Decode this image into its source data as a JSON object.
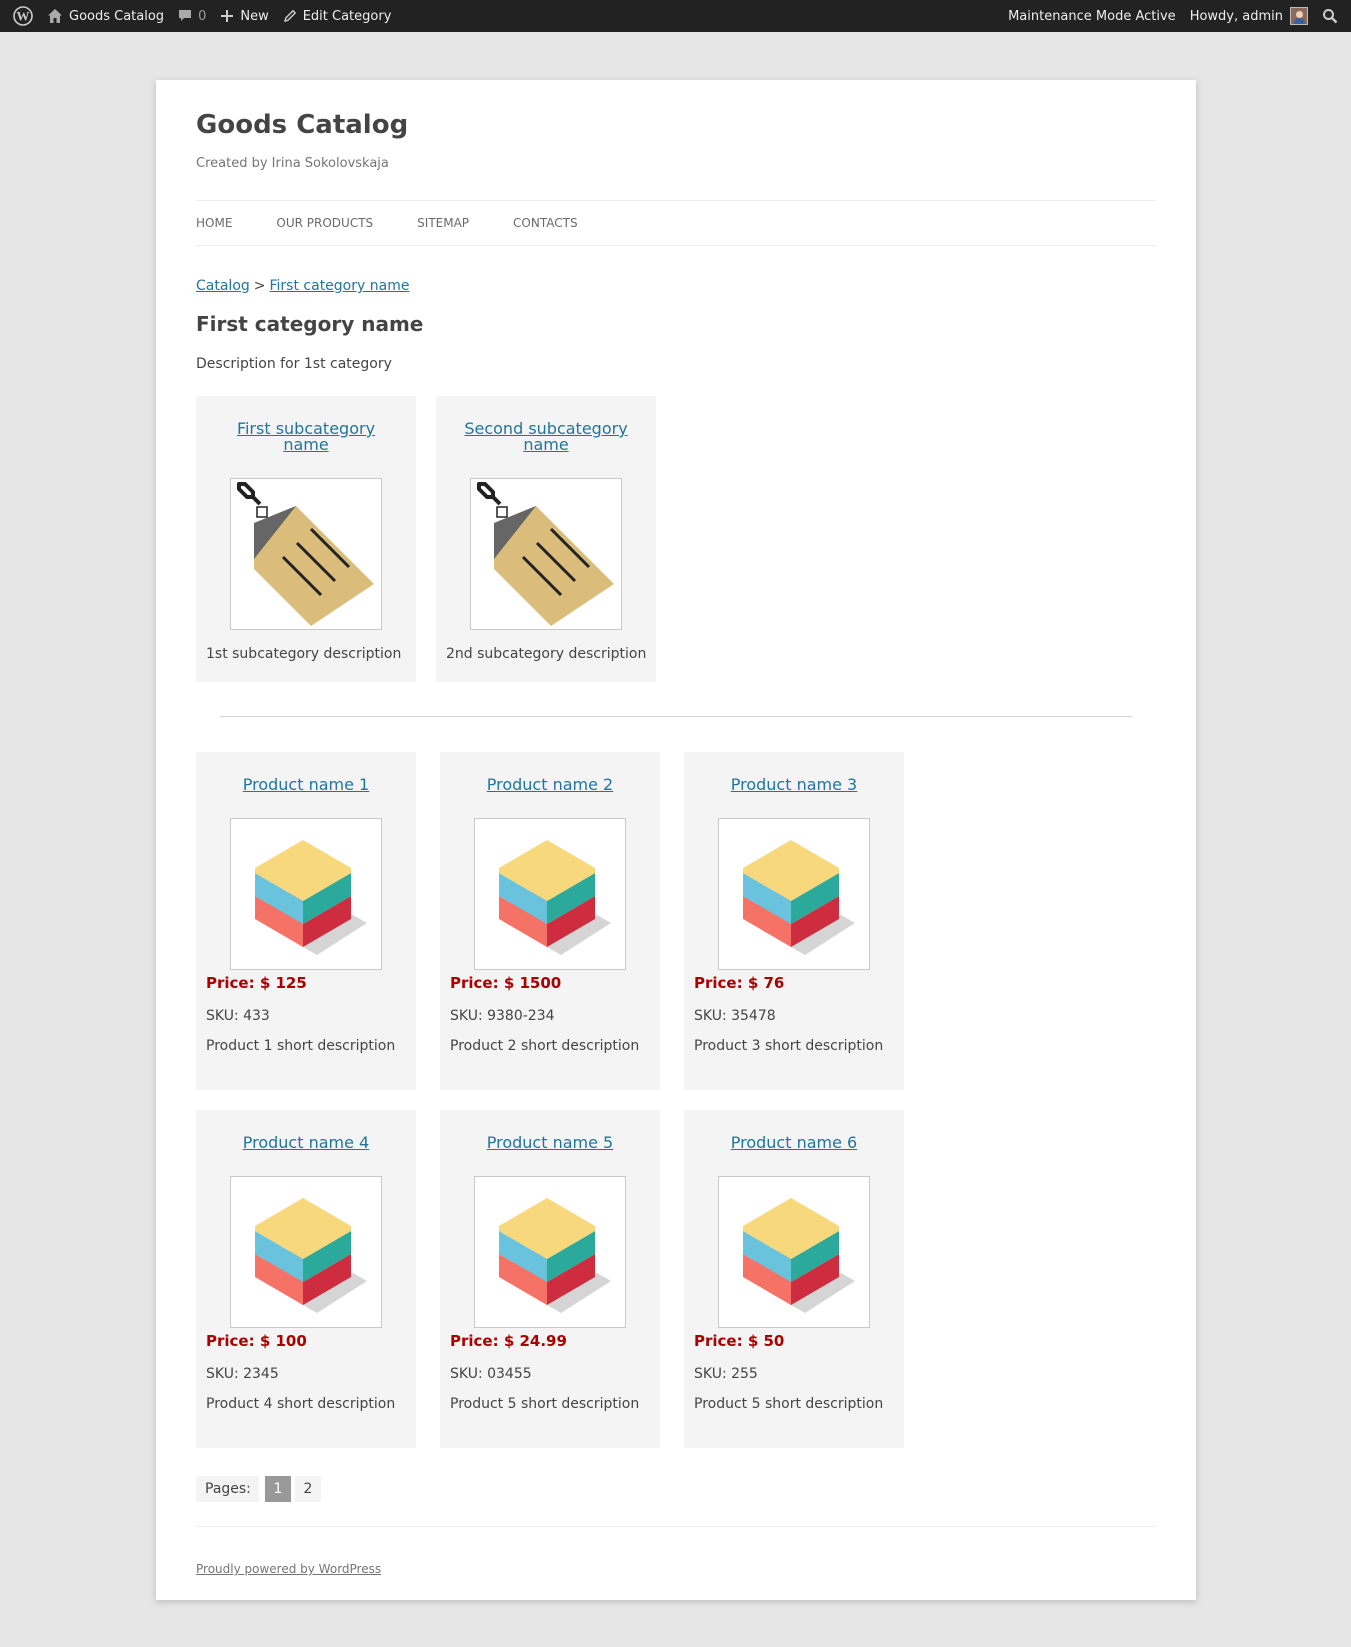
{
  "admin_bar": {
    "site_name": "Goods Catalog",
    "comments_count": "0",
    "new_label": "New",
    "edit_label": "Edit Category",
    "maintenance_label": "Maintenance Mode Active",
    "howdy_label": "Howdy, admin"
  },
  "site": {
    "title": "Goods Catalog",
    "description": "Created by Irina Sokolovskaja"
  },
  "nav": {
    "items": [
      {
        "label": "HOME"
      },
      {
        "label": "OUR PRODUCTS"
      },
      {
        "label": "SITEMAP"
      },
      {
        "label": "CONTACTS"
      }
    ]
  },
  "breadcrumb": {
    "root": "Catalog",
    "separator": ">",
    "current": "First category name"
  },
  "category": {
    "title": "First category name",
    "description": "Description for 1st category"
  },
  "subcategories": [
    {
      "title_line1": "First subcategory",
      "title_line2": "name",
      "description": "1st subcategory description"
    },
    {
      "title_line1": "Second subcategory",
      "title_line2": "name",
      "description": "2nd subcategory description"
    }
  ],
  "products": [
    {
      "name": "Product name 1",
      "price": "Price: $ 125",
      "sku": "SKU: 433",
      "description": "Product 1 short description"
    },
    {
      "name": "Product name 2",
      "price": "Price: $ 1500",
      "sku": "SKU: 9380-234",
      "description": "Product 2 short description"
    },
    {
      "name": "Product name 3",
      "price": "Price: $ 76",
      "sku": "SKU: 35478",
      "description": "Product 3 short description"
    },
    {
      "name": "Product name 4",
      "price": "Price: $ 100",
      "sku": "SKU: 2345",
      "description": "Product 4 short description"
    },
    {
      "name": "Product name 5",
      "price": "Price: $ 24.99",
      "sku": "SKU: 03455",
      "description": "Product 5 short description"
    },
    {
      "name": "Product name 6",
      "price": "Price: $ 50",
      "sku": "SKU: 255",
      "description": "Product 5 short description"
    }
  ],
  "pagination": {
    "label": "Pages:",
    "pages": [
      "1",
      "2"
    ],
    "current": "1"
  },
  "footer": {
    "credit": "Proudly powered by WordPress"
  },
  "colors": {
    "admin_bar_bg": "#222222",
    "link": "#21759b",
    "price": "#aa0000",
    "card_bg": "#f4f4f4",
    "page_bg": "#e6e6e6"
  }
}
